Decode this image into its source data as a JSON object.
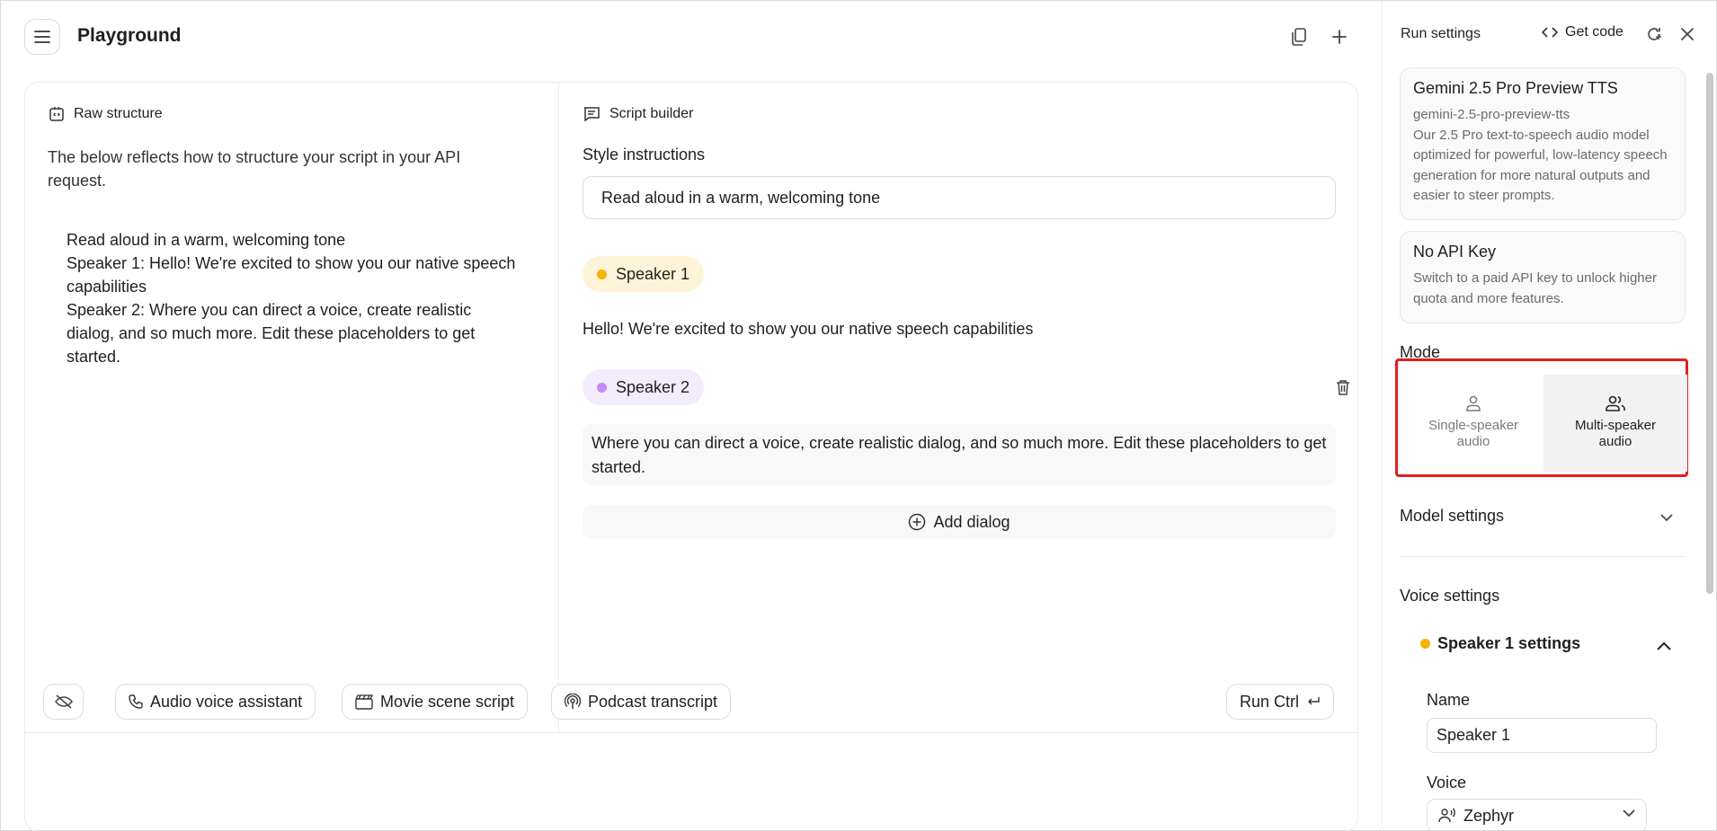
{
  "header": {
    "title": "Playground"
  },
  "raw_structure": {
    "title": "Raw structure",
    "description": "The below reflects how to structure your script in your API request.",
    "lines": [
      "Read aloud in a warm, welcoming tone",
      "Speaker 1: Hello! We're excited to show you our native speech capabilities",
      "Speaker 2: Where you can direct a voice, create realistic dialog, and so much more. Edit these placeholders to get started."
    ]
  },
  "script_builder": {
    "title": "Script builder",
    "style_label": "Style instructions",
    "style_value": "Read aloud in a warm, welcoming tone",
    "speaker1": {
      "name": "Speaker 1",
      "text": "Hello! We're excited to show you our native speech capabilities",
      "color": "#f5b400"
    },
    "speaker2": {
      "name": "Speaker 2",
      "text": "Where you can direct a voice, create realistic dialog, and so much more. Edit these placeholders to get started.",
      "color": "#c58af9"
    },
    "add_dialog": "Add dialog"
  },
  "bottom_bar": {
    "audio_voice_assistant": "Audio voice assistant",
    "movie_scene_script": "Movie scene script",
    "podcast_transcript": "Podcast transcript",
    "run": "Run Ctrl"
  },
  "run_settings": {
    "title": "Run settings",
    "get_code": "Get code",
    "model_card": {
      "title": "Gemini 2.5 Pro Preview TTS",
      "id": "gemini-2.5-pro-preview-tts",
      "description": "Our 2.5 Pro text-to-speech audio model optimized for powerful, low-latency speech generation for more natural outputs and easier to steer prompts."
    },
    "api_card": {
      "title": "No API Key",
      "description": "Switch to a paid API key to unlock higher quota and more features."
    },
    "mode": {
      "label": "Mode",
      "single": [
        "Single-speaker",
        "audio"
      ],
      "multi": [
        "Multi-speaker",
        "audio"
      ],
      "selected": "Multi-speaker audio"
    },
    "model_settings": "Model settings",
    "voice_settings": "Voice settings",
    "speaker1_settings": {
      "title": "Speaker 1 settings",
      "name_label": "Name",
      "name_value": "Speaker 1",
      "voice_label": "Voice",
      "voice_value": "Zephyr"
    }
  },
  "colors": {
    "highlight_border": "#e02020",
    "speaker1": "#f5b400",
    "speaker2": "#c58af9"
  }
}
